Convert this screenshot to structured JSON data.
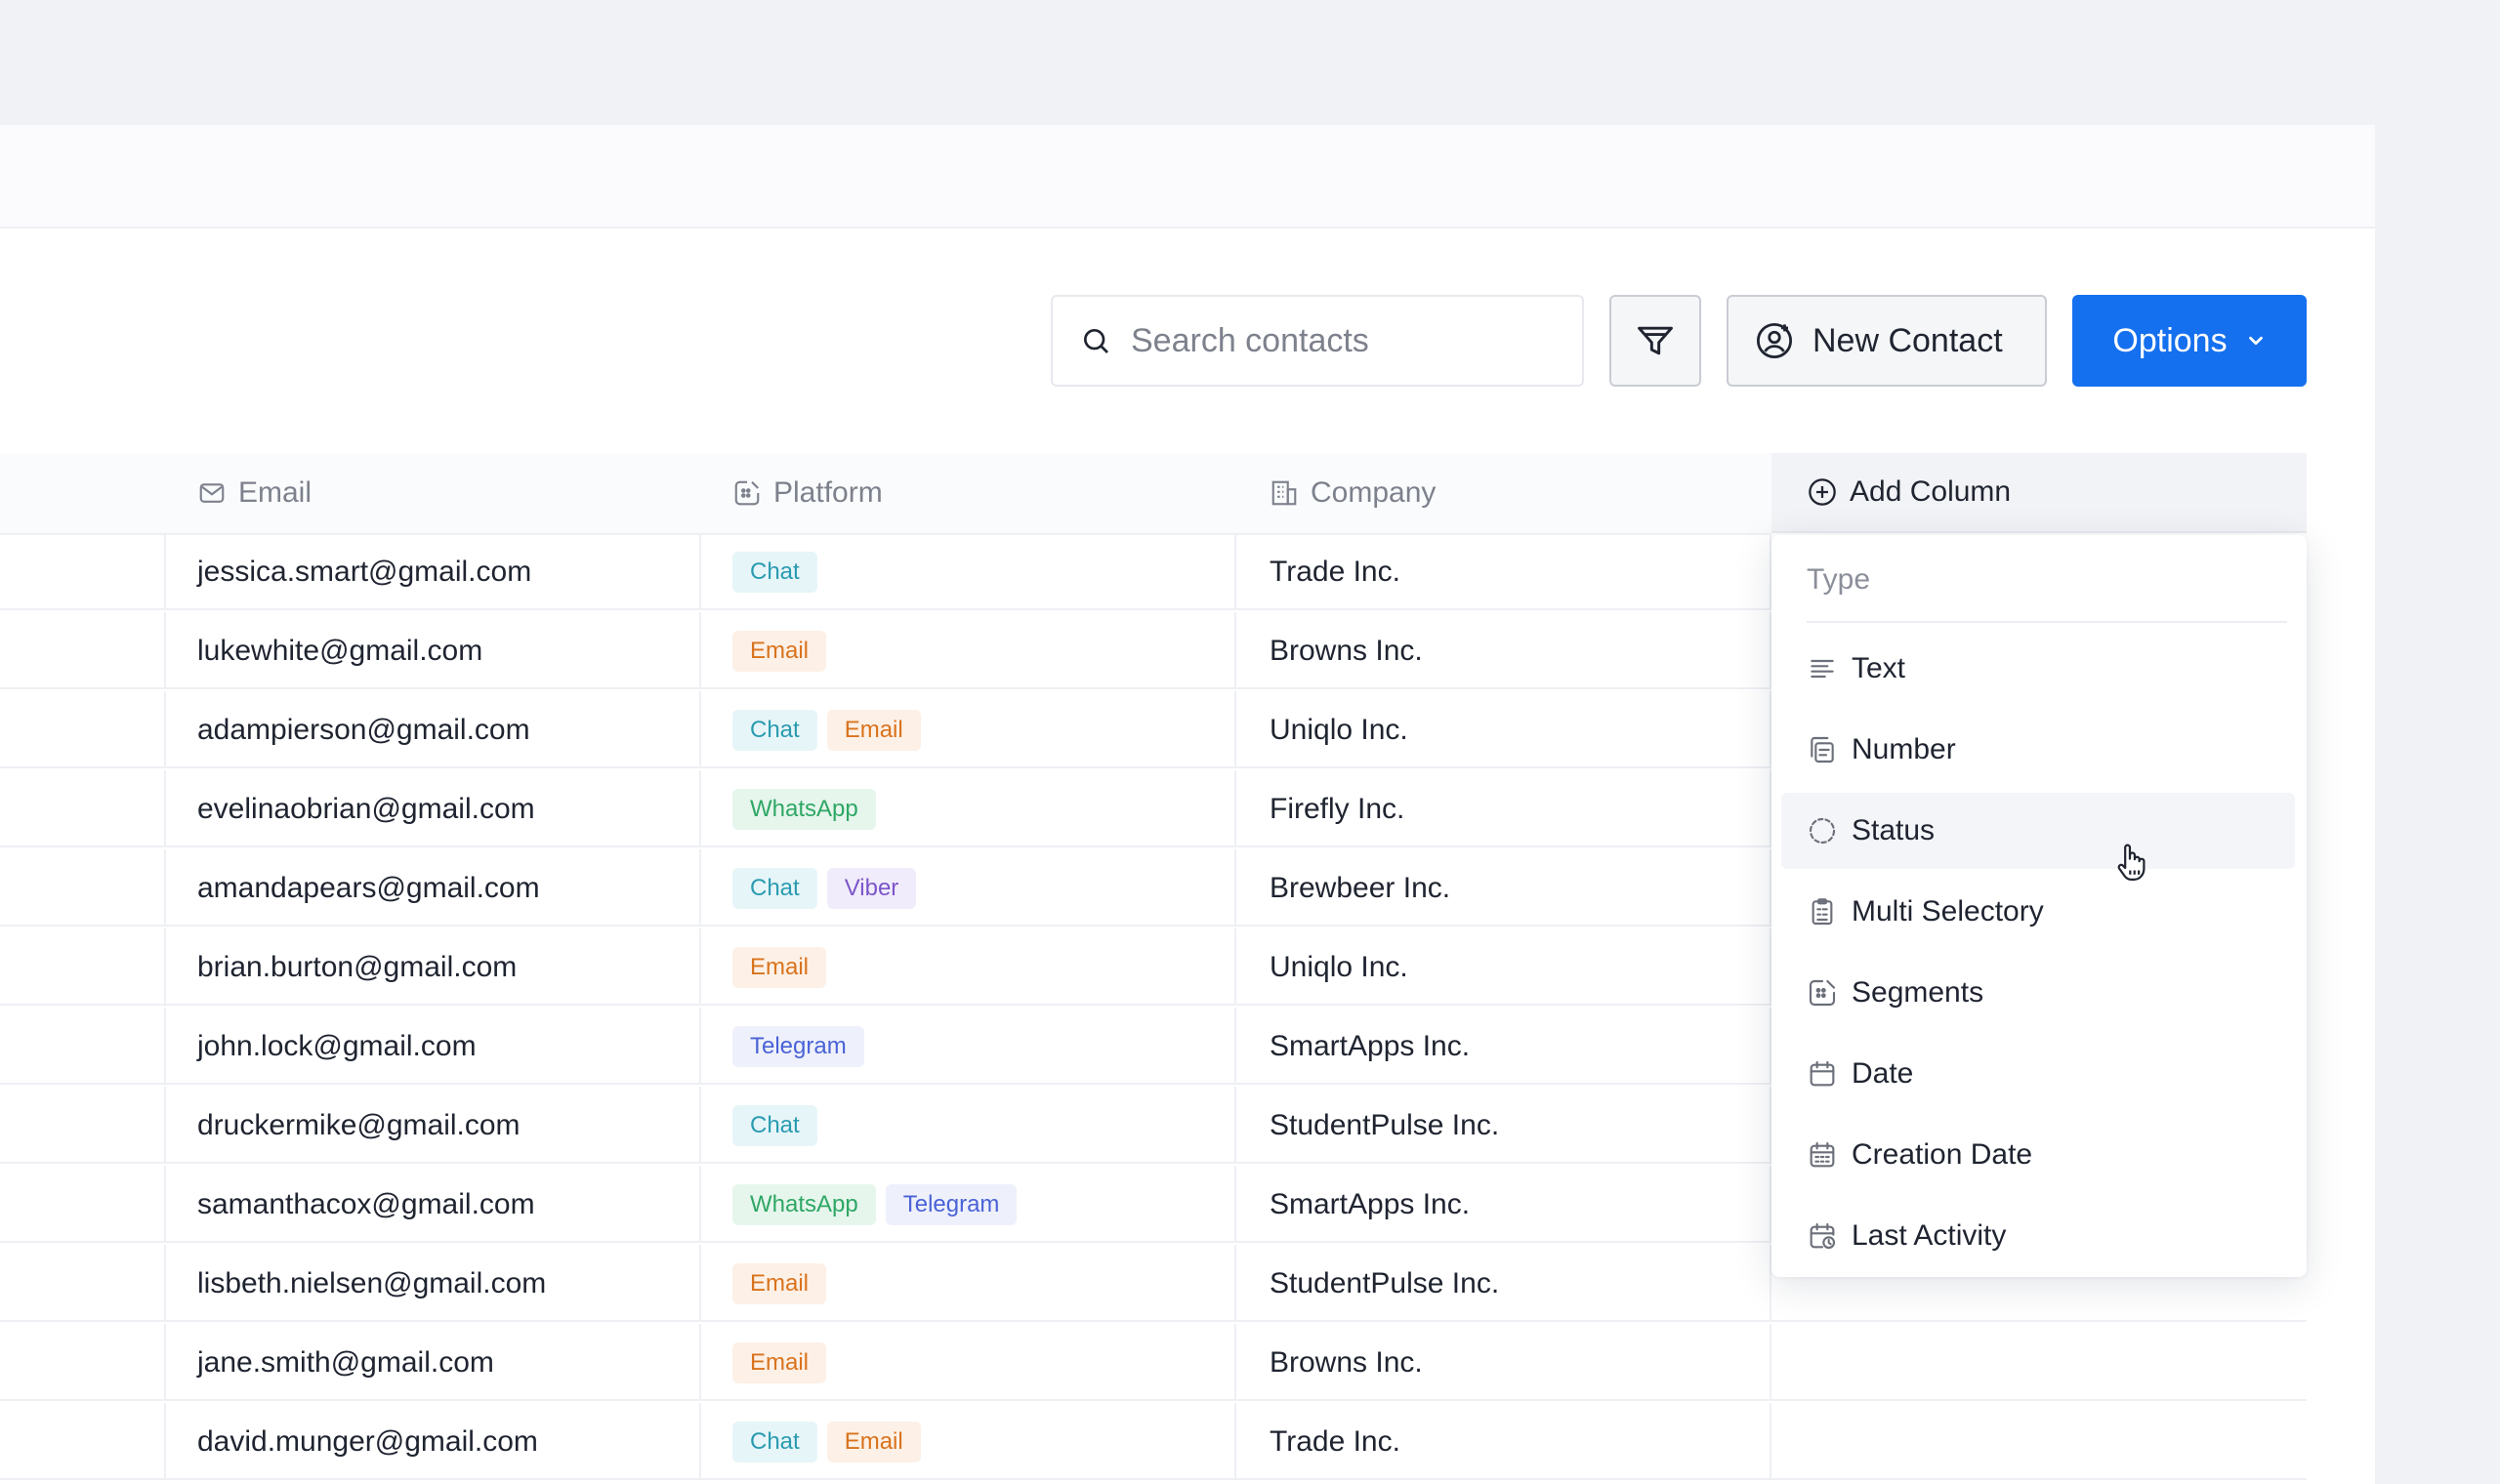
{
  "toolbar": {
    "search_placeholder": "Search contacts",
    "new_contact_label": "New Contact",
    "options_label": "Options"
  },
  "table": {
    "columns": {
      "email": "Email",
      "platform": "Platform",
      "company": "Company",
      "add_column": "Add Column"
    },
    "rows": [
      {
        "email": "jessica.smart@gmail.com",
        "platforms": [
          "Chat"
        ],
        "company": "Trade Inc."
      },
      {
        "email": "lukewhite@gmail.com",
        "platforms": [
          "Email"
        ],
        "company": "Browns Inc."
      },
      {
        "email": "adampierson@gmail.com",
        "platforms": [
          "Chat",
          "Email"
        ],
        "company": "Uniqlo Inc."
      },
      {
        "email": "evelinaobrian@gmail.com",
        "platforms": [
          "WhatsApp"
        ],
        "company": "Firefly Inc."
      },
      {
        "email": "amandapears@gmail.com",
        "platforms": [
          "Chat",
          "Viber"
        ],
        "company": "Brewbeer Inc."
      },
      {
        "email": "brian.burton@gmail.com",
        "platforms": [
          "Email"
        ],
        "company": "Uniqlo Inc."
      },
      {
        "email": "john.lock@gmail.com",
        "platforms": [
          "Telegram"
        ],
        "company": "SmartApps Inc."
      },
      {
        "email": "druckermike@gmail.com",
        "platforms": [
          "Chat"
        ],
        "company": "StudentPulse Inc."
      },
      {
        "email": "samanthacox@gmail.com",
        "platforms": [
          "WhatsApp",
          "Telegram"
        ],
        "company": "SmartApps Inc."
      },
      {
        "email": "lisbeth.nielsen@gmail.com",
        "platforms": [
          "Email"
        ],
        "company": "StudentPulse Inc."
      },
      {
        "email": "jane.smith@gmail.com",
        "platforms": [
          "Email"
        ],
        "company": "Browns Inc."
      },
      {
        "email": "david.munger@gmail.com",
        "platforms": [
          "Chat",
          "Email"
        ],
        "company": "Trade Inc."
      }
    ]
  },
  "platform_colors": {
    "Chat": {
      "bg": "#e6f5f8",
      "fg": "#2a9bb0"
    },
    "Email": {
      "bg": "#fdf0e6",
      "fg": "#d9731d"
    },
    "WhatsApp": {
      "bg": "#e6f6ec",
      "fg": "#2fa765"
    },
    "Viber": {
      "bg": "#f1ecfb",
      "fg": "#7b56c9"
    },
    "Telegram": {
      "bg": "#eef1fb",
      "fg": "#4a62d6"
    }
  },
  "dropdown": {
    "title": "Type",
    "items": [
      {
        "label": "Text",
        "icon": "text-lines-icon"
      },
      {
        "label": "Number",
        "icon": "number-icon"
      },
      {
        "label": "Status",
        "icon": "status-circle-icon",
        "hovered": true
      },
      {
        "label": "Multi Selectory",
        "icon": "clipboard-list-icon"
      },
      {
        "label": "Segments",
        "icon": "segments-icon"
      },
      {
        "label": "Date",
        "icon": "calendar-icon"
      },
      {
        "label": "Creation Date",
        "icon": "calendar-grid-icon"
      },
      {
        "label": "Last Activity",
        "icon": "calendar-clock-icon"
      }
    ]
  },
  "colors": {
    "accent": "#1570ef",
    "background": "#f1f2f6"
  }
}
